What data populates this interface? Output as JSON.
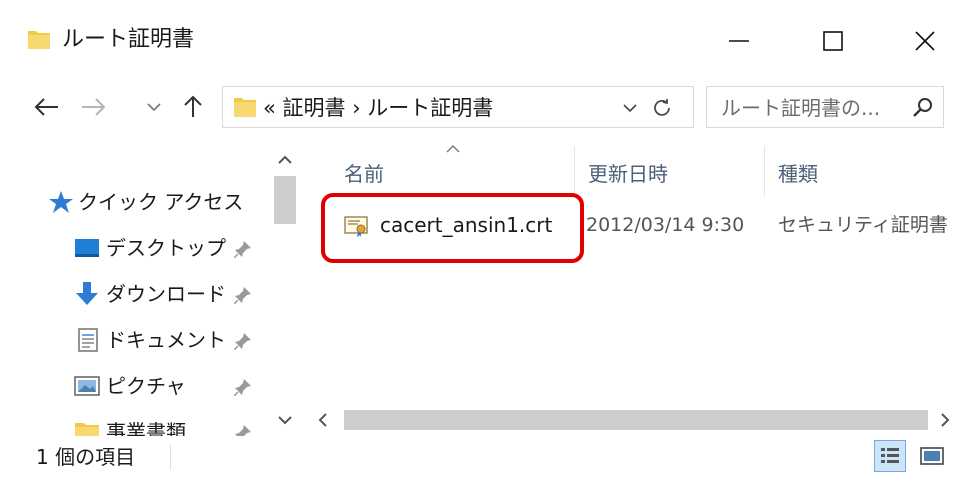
{
  "window": {
    "title": "ルート証明書",
    "colors": {
      "accent": "#e00000",
      "folder": "#f3c94a",
      "selection": "#cce4f7"
    }
  },
  "nav": {
    "back_icon": "arrow-left-icon",
    "forward_icon": "arrow-right-icon",
    "recent_icon": "chevron-down-icon",
    "up_icon": "arrow-up-icon"
  },
  "address": {
    "text": "« 証明書 › ルート証明書"
  },
  "search": {
    "placeholder": "ルート証明書の..."
  },
  "sidebar": {
    "items": [
      {
        "label": "クイック アクセス",
        "icon": "star-icon",
        "pinned": false
      },
      {
        "label": "デスクトップ",
        "icon": "desktop-icon",
        "pinned": true
      },
      {
        "label": "ダウンロード",
        "icon": "download-icon",
        "pinned": true
      },
      {
        "label": "ドキュメント",
        "icon": "document-icon",
        "pinned": true
      },
      {
        "label": "ピクチャ",
        "icon": "picture-icon",
        "pinned": true
      },
      {
        "label": "事業書類",
        "icon": "folder-icon",
        "pinned": true
      }
    ]
  },
  "columns": {
    "name": "名前",
    "modified": "更新日時",
    "type": "種類"
  },
  "files": [
    {
      "name": "cacert_ansin1.crt",
      "modified": "2012/03/14 9:30",
      "type": "セキュリティ証明書",
      "icon": "certificate-icon"
    }
  ],
  "status": {
    "count": "1 個の項目"
  }
}
